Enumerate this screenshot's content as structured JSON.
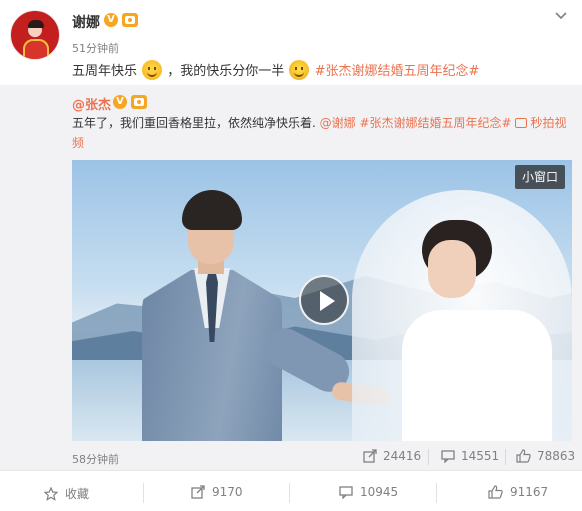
{
  "post": {
    "username": "谢娜",
    "time": "51分钟前",
    "text_before": "五周年快乐",
    "text_mid": "，我的快乐分你一半",
    "hashtag": "#张杰谢娜结婚五周年纪念#"
  },
  "repost": {
    "username": "@张杰",
    "text": "五年了，我们重回香格里拉，依然纯净快乐着.",
    "mention": "@谢娜",
    "hashtag": "#张杰谢娜结婚五周年纪念#",
    "video_link": "秒拍视频",
    "mini_window": "小窗口",
    "time": "58分钟前",
    "stats": {
      "forward": "24416",
      "comment": "14551",
      "like": "78863"
    }
  },
  "footer": {
    "favorite": "收藏",
    "forward": "9170",
    "comment": "10945",
    "like": "91167"
  },
  "colors": {
    "accent": "#eb7350",
    "badge": "#f6a623",
    "muted": "#808080"
  }
}
